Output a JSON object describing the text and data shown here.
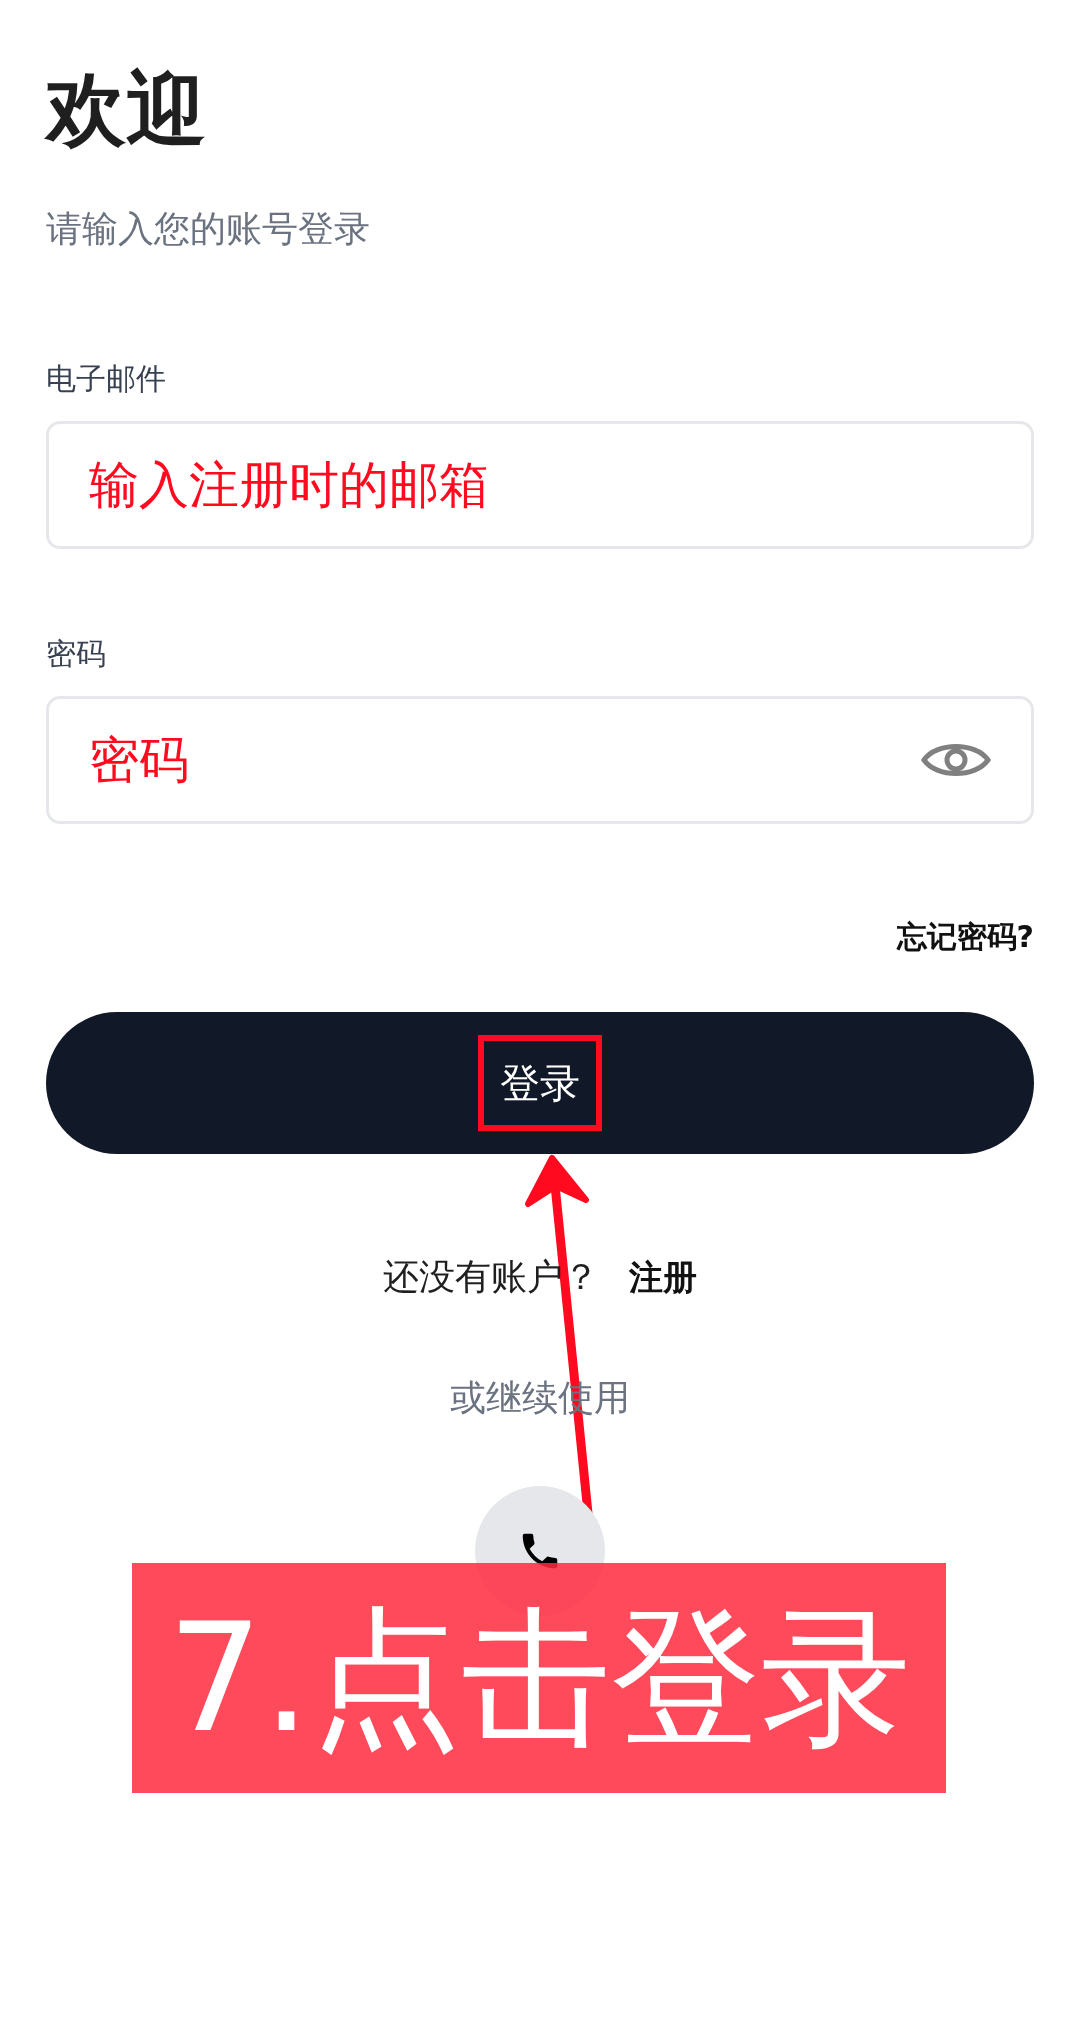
{
  "header": {
    "title": "欢迎",
    "subtitle": "请输入您的账号登录"
  },
  "fields": [
    {
      "label": "电子邮件",
      "annotation": "输入注册时的邮箱",
      "kind": "text"
    },
    {
      "label": "密码",
      "annotation": "密码",
      "kind": "password"
    }
  ],
  "forgot_link": "忘记密码?",
  "login_button": {
    "label": "登录",
    "highlighted": true
  },
  "signup": {
    "prompt": "还没有账户？",
    "link": "注册"
  },
  "divider_text": "或继续使用",
  "banner": {
    "text": "7.点击登录"
  }
}
